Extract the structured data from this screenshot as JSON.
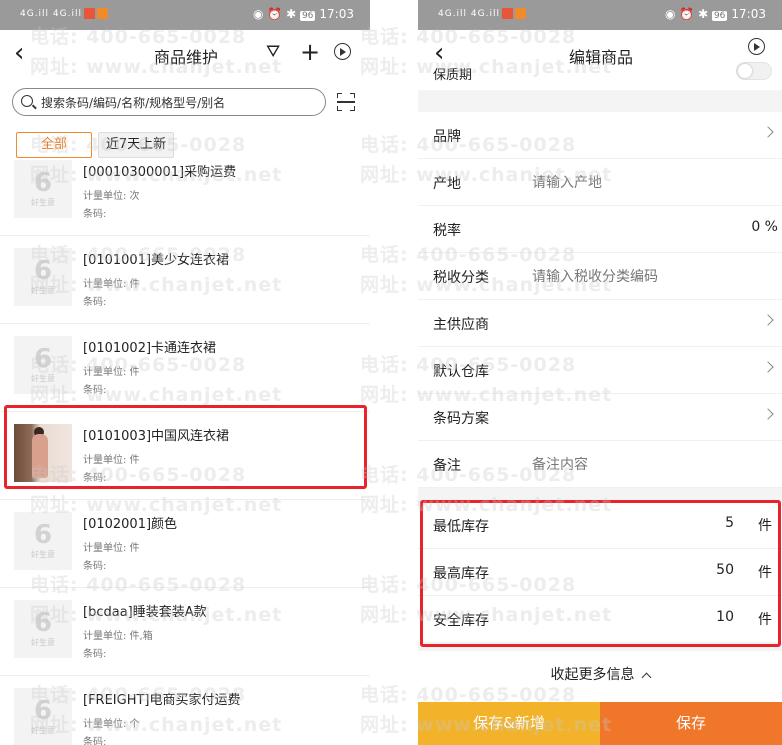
{
  "status_bar": {
    "signal": "4G.ill 4G.ill",
    "battery": "96",
    "time": "17:03"
  },
  "left": {
    "title": "商品维护",
    "search_placeholder": "搜索条码/编码/名称/规格型号/别名",
    "tabs": [
      "全部",
      "近7天上新"
    ],
    "placeholder_logo": "6",
    "placeholder_logo_text": "好生意",
    "items": [
      {
        "title": "[00010300001]采购运费",
        "unit": "计量单位: 次",
        "code": "条码:"
      },
      {
        "title": "[0101001]美少女连衣裙",
        "unit": "计量单位: 件",
        "code": "条码:"
      },
      {
        "title": "[0101002]卡通连衣裙",
        "unit": "计量单位: 件",
        "code": "条码:"
      },
      {
        "title": "[0101003]中国风连衣裙",
        "unit": "计量单位: 件",
        "code": "条码:"
      },
      {
        "title": "[0102001]颜色",
        "unit": "计量单位: 件",
        "code": "条码:"
      },
      {
        "title": "[bcdaa]睡装套装A款",
        "unit": "计量单位: 件,箱",
        "code": "条码:"
      },
      {
        "title": "[FREIGHT]电商买家付运费",
        "unit": "计量单位: 个",
        "code": "条码:"
      }
    ]
  },
  "right": {
    "title": "编辑商品",
    "partial_field": "保质期",
    "fields": [
      {
        "label": "品牌"
      },
      {
        "label": "产地",
        "placeholder": "请输入产地"
      },
      {
        "label": "税率",
        "value": "0 %"
      },
      {
        "label": "税收分类",
        "placeholder": "请输入税收分类编码"
      },
      {
        "label": "主供应商"
      },
      {
        "label": "默认仓库"
      },
      {
        "label": "条码方案"
      },
      {
        "label": "备注",
        "placeholder": "备注内容"
      }
    ],
    "stock": [
      {
        "label": "最低库存",
        "value": "5",
        "unit": "件"
      },
      {
        "label": "最高库存",
        "value": "50",
        "unit": "件"
      },
      {
        "label": "安全库存",
        "value": "10",
        "unit": "件"
      }
    ],
    "collapse_label": "收起更多信息",
    "buttons": {
      "save_new": "保存&新增",
      "save": "保存"
    }
  },
  "watermark": {
    "phone": "电话: 400-665-0028",
    "site": "网址: www.chanjet.net"
  },
  "colors": {
    "accent_orange": "#f0762a",
    "accent_yellow": "#f2b32a",
    "highlight_red": "#e8232b"
  }
}
